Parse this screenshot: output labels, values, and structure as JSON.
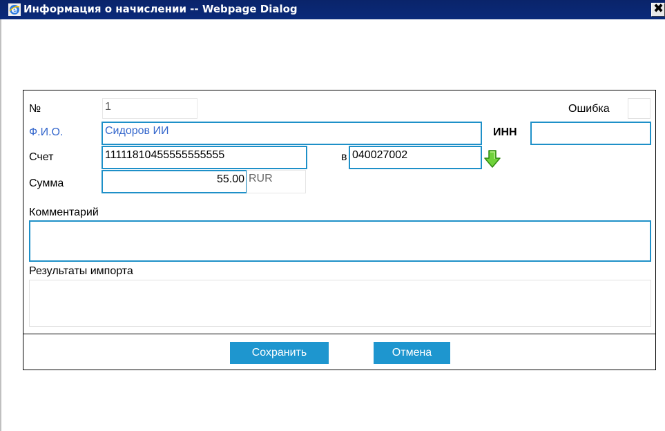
{
  "window": {
    "title": "Информация о начислении -- Webpage Dialog",
    "close_label": "✖"
  },
  "form": {
    "number_label": "№",
    "number_value": "1",
    "error_label": "Ошибка",
    "error_value": "",
    "fio_label": "Ф.И.О.",
    "fio_value": "Сидоров ИИ",
    "inn_label": "ИНН",
    "inn_value": "",
    "account_label": "Счет",
    "account_value": "11111810455555555555",
    "in_label": "в",
    "bik_value": "040027002",
    "amount_label": "Сумма",
    "amount_value": "55.00",
    "currency": "RUR",
    "comment_label": "Комментарий",
    "comment_value": "",
    "import_label": "Результаты импорта",
    "import_value": ""
  },
  "buttons": {
    "save": "Сохранить",
    "cancel": "Отмена"
  },
  "colors": {
    "titlebar": "#0a246a",
    "accent": "#1e96cf",
    "field_border_active": "#1e90c8",
    "link_text": "#3366cc"
  }
}
